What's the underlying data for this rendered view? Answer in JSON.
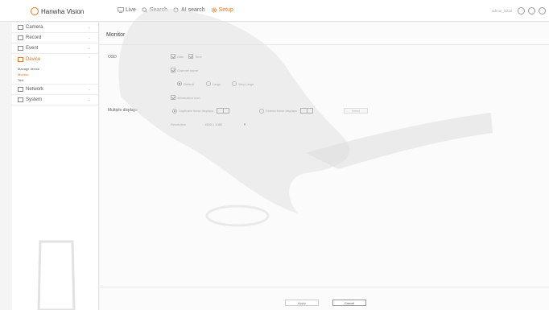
{
  "header": {
    "logo_text": "Hanwha Vision",
    "nav": [
      {
        "label": "Live",
        "icon": "monitor-icon"
      },
      {
        "label": "Search",
        "icon": "search-icon"
      },
      {
        "label": "AI search",
        "icon": "ai-search-icon"
      },
      {
        "label": "Setup",
        "icon": "gear-icon",
        "active": true
      }
    ],
    "user_text": "admin_initial",
    "accent_color": "#e8721f"
  },
  "sidebar": {
    "items": [
      {
        "label": "Camera",
        "icon": "camera-icon"
      },
      {
        "label": "Record",
        "icon": "record-icon"
      },
      {
        "label": "Event",
        "icon": "event-icon"
      },
      {
        "label": "Device",
        "icon": "device-icon",
        "open": true
      }
    ],
    "device_sub": [
      {
        "label": "Manage device"
      },
      {
        "label": "Monitor",
        "active": true
      },
      {
        "label": "Text"
      }
    ],
    "items_after": [
      {
        "label": "Network",
        "icon": "network-icon"
      },
      {
        "label": "System",
        "icon": "system-icon"
      }
    ]
  },
  "main": {
    "title": "Monitor",
    "osd_label": "OSD",
    "osd_date": "Date",
    "osd_time": "Time",
    "channel_name": "Channel name",
    "size_default": "Default",
    "size_large": "Large",
    "size_very_large": "Very Large",
    "information_icon": "Information icon",
    "multiple_displays_label": "Multiple displays",
    "duplicate_displays": "Duplicate these displays",
    "extend_displays": "Extend these displays",
    "ghost_field_text": "Detect",
    "resolution_label": "Resolution",
    "resolution_value": "1920 x 1080",
    "apply_button": "Apply",
    "cancel_button": "Cancel"
  }
}
